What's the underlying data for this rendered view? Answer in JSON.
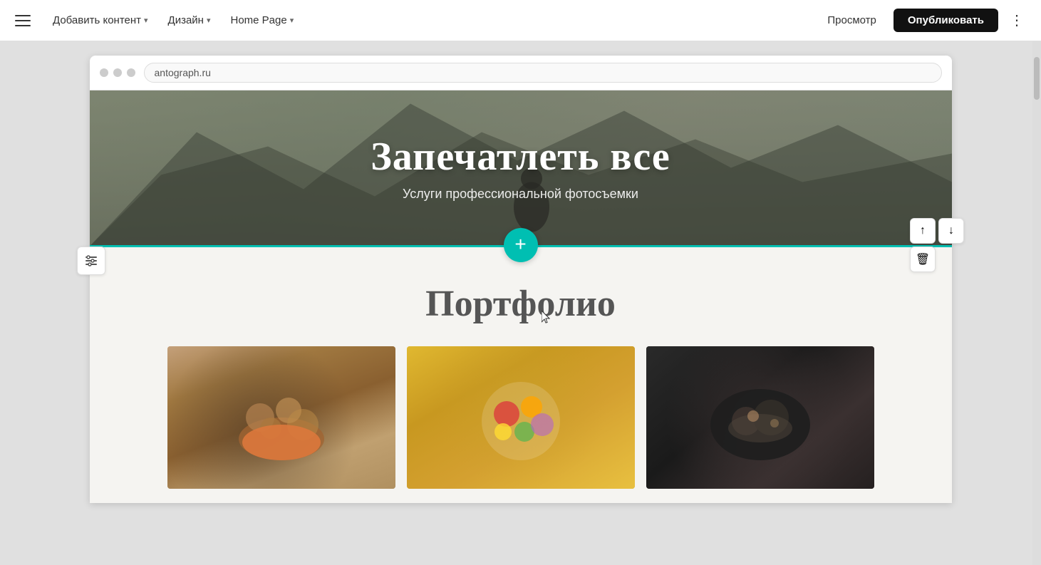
{
  "topbar": {
    "menu_icon": "hamburger-menu",
    "add_content_label": "Добавить контент",
    "design_label": "Дизайн",
    "page_label": "Home Page",
    "preview_label": "Просмотр",
    "publish_label": "Опубликовать",
    "more_icon": "⋮"
  },
  "browser": {
    "url": "antograph.ru"
  },
  "hero": {
    "title": "Запечатлеть все",
    "subtitle": "Услуги профессиональной фотосъемки"
  },
  "portfolio": {
    "title": "Портфолио"
  },
  "add_section": {
    "icon": "+"
  },
  "right_panel": {
    "up_icon": "↑",
    "down_icon": "↓",
    "delete_icon": "🗑"
  }
}
